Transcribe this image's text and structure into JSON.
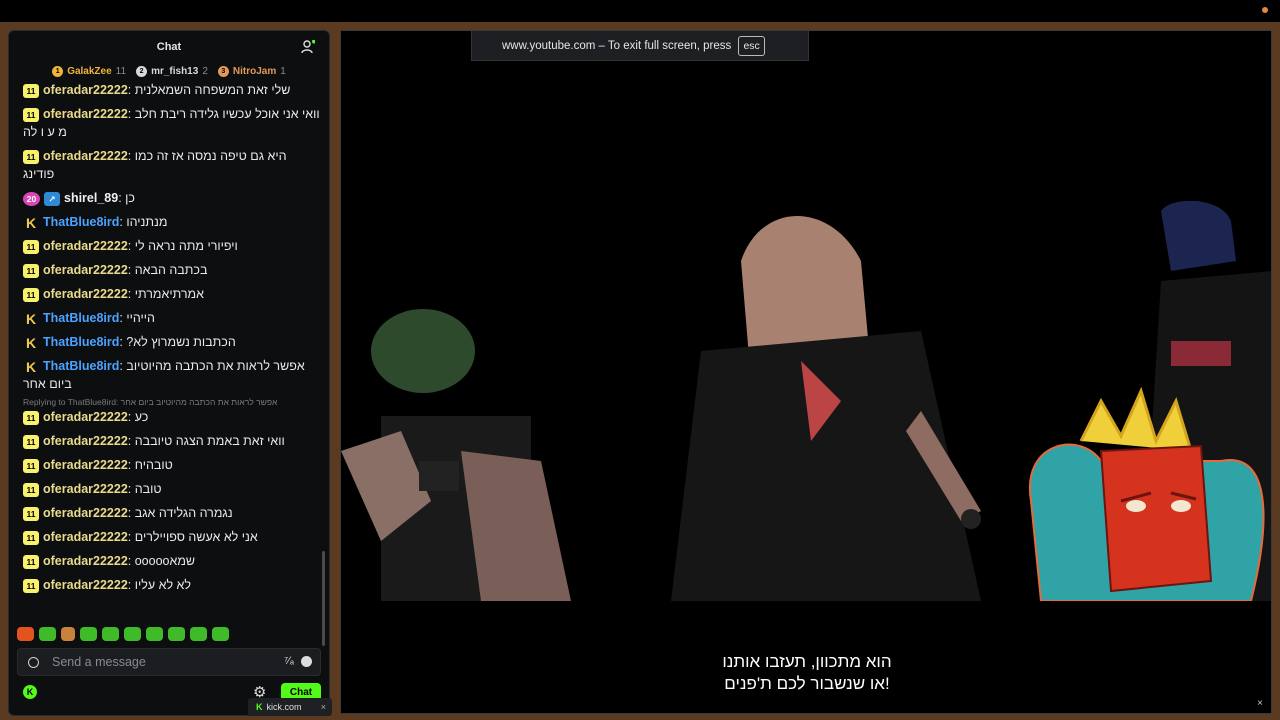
{
  "chat": {
    "title": "Chat",
    "leaders": [
      {
        "rank": "1",
        "name": "GalakZee",
        "count": "11",
        "color": "#f0b43c"
      },
      {
        "rank": "2",
        "name": "mr_fish13",
        "count": "2",
        "color": "#d9d9d9"
      },
      {
        "rank": "3",
        "name": "NitroJam",
        "count": "1",
        "color": "#e09a5a"
      }
    ],
    "messages": [
      {
        "badge": "11",
        "badge_type": "yellow",
        "user": "oferadar22222",
        "name_color": "yellow",
        "text": "שלי זאת המשפחה השמאלנית",
        "reply": ""
      },
      {
        "badge": "11",
        "badge_type": "yellow",
        "user": "oferadar22222",
        "name_color": "yellow",
        "text": "וואי אני אוכל עכשיו גלידה ריבת חלב מ ע ו לה",
        "reply": ""
      },
      {
        "badge": "11",
        "badge_type": "yellow",
        "user": "oferadar22222",
        "name_color": "yellow",
        "text": "היא גם טיפה נמסה אז זה כמו פודינג",
        "reply": ""
      },
      {
        "badge": "20",
        "badge_type": "sub",
        "user": "shirel_89",
        "name_color": "white",
        "text": "כן",
        "reply": ""
      },
      {
        "badge": "K",
        "badge_type": "k",
        "user": "ThatBlue8ird",
        "name_color": "blue",
        "text": "מנתניהו",
        "reply": ""
      },
      {
        "badge": "11",
        "badge_type": "yellow",
        "user": "oferadar22222",
        "name_color": "yellow",
        "text": "ויפיורי מתה נראה לי",
        "reply": ""
      },
      {
        "badge": "11",
        "badge_type": "yellow",
        "user": "oferadar22222",
        "name_color": "yellow",
        "text": "בכתבה הבאה",
        "reply": ""
      },
      {
        "badge": "11",
        "badge_type": "yellow",
        "user": "oferadar22222",
        "name_color": "yellow",
        "text": "אמרתיאמרתי",
        "reply": ""
      },
      {
        "badge": "K",
        "badge_type": "k",
        "user": "ThatBlue8ird",
        "name_color": "blue",
        "text": "הייהיי",
        "reply": ""
      },
      {
        "badge": "K",
        "badge_type": "k",
        "user": "ThatBlue8ird",
        "name_color": "blue",
        "text": "הכתבות נשמרוץ לא?",
        "reply": ""
      },
      {
        "badge": "K",
        "badge_type": "k",
        "user": "ThatBlue8ird",
        "name_color": "blue",
        "text": "אפשר לראות את הכתבה מהיוטיוב ביום אחר",
        "reply": ""
      },
      {
        "badge": "11",
        "badge_type": "yellow",
        "user": "oferadar22222",
        "name_color": "yellow",
        "text": "כע",
        "reply": "Replying to ThatBlue8ird: אפשר לראות את הכתבה מהיוטיוב ביום אחר"
      },
      {
        "badge": "11",
        "badge_type": "yellow",
        "user": "oferadar22222",
        "name_color": "yellow",
        "text": "וואי זאת באמת הצגה טיובבה",
        "reply": ""
      },
      {
        "badge": "11",
        "badge_type": "yellow",
        "user": "oferadar22222",
        "name_color": "yellow",
        "text": "טובהיח",
        "reply": ""
      },
      {
        "badge": "11",
        "badge_type": "yellow",
        "user": "oferadar22222",
        "name_color": "yellow",
        "text": "טובה",
        "reply": ""
      },
      {
        "badge": "11",
        "badge_type": "yellow",
        "user": "oferadar22222",
        "name_color": "yellow",
        "text": "נגמרה הגלידה אגב",
        "reply": ""
      },
      {
        "badge": "11",
        "badge_type": "yellow",
        "user": "oferadar22222",
        "name_color": "yellow",
        "text": "אני לא אעשה ספויילרים",
        "reply": ""
      },
      {
        "badge": "11",
        "badge_type": "yellow",
        "user": "oferadar22222",
        "name_color": "yellow",
        "text": "שמאooooo",
        "reply": ""
      },
      {
        "badge": "11",
        "badge_type": "yellow",
        "user": "oferadar22222",
        "name_color": "yellow",
        "text": "לא לא עליו",
        "reply": ""
      }
    ],
    "input_placeholder": "Send a message",
    "send_label": "Chat"
  },
  "tab": {
    "label": "kick.com",
    "close": "×"
  },
  "video": {
    "fullscreen_notice": "www.youtube.com – To exit full screen, press",
    "esc_key": "esc",
    "subtitle_line1": "הוא מתכוון, תעזבו אותנו",
    "subtitle_line2": "!או שנשבור לכם ת'פנים",
    "close": "×"
  },
  "colors": {
    "accent": "#53fc18",
    "frame": "#5a3b22",
    "sub_badge": "#f7f16b"
  }
}
